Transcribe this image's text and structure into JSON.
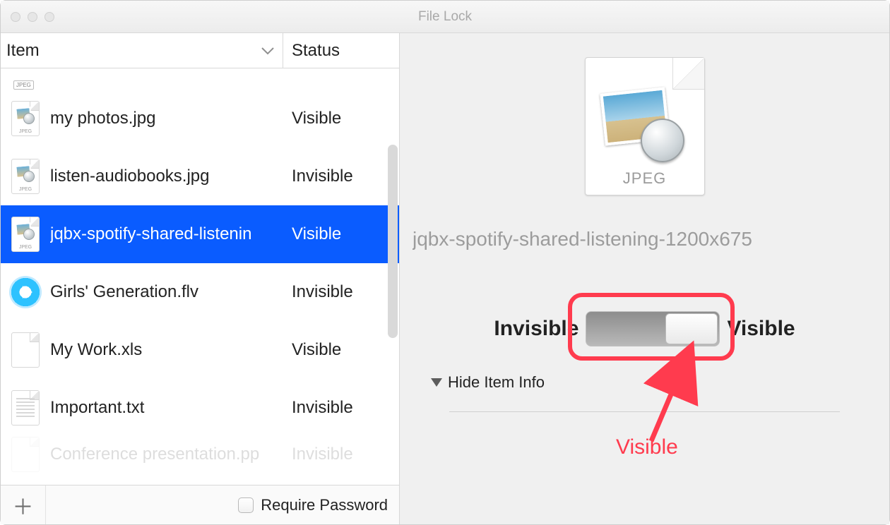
{
  "window": {
    "title": "File Lock"
  },
  "columns": {
    "item": "Item",
    "status": "Status"
  },
  "list": {
    "leading_tag": "JPEG",
    "items": [
      {
        "name": "my photos.jpg",
        "status": "Visible",
        "icon": "jpeg",
        "selected": false
      },
      {
        "name": "listen-audiobooks.jpg",
        "status": "Invisible",
        "icon": "jpeg",
        "selected": false
      },
      {
        "name": "jqbx-spotify-shared-listenin",
        "status": "Visible",
        "icon": "jpeg",
        "selected": true
      },
      {
        "name": "Girls' Generation.flv",
        "status": "Invisible",
        "icon": "flv",
        "selected": false
      },
      {
        "name": "My Work.xls",
        "status": "Visible",
        "icon": "xls",
        "selected": false
      },
      {
        "name": "Important.txt",
        "status": "Invisible",
        "icon": "txt",
        "selected": false
      }
    ],
    "trailing_partial": {
      "name": "Conference presentation.pp",
      "status": "Invisible"
    }
  },
  "bottom": {
    "require_password": "Require Password"
  },
  "detail": {
    "filetype_label": "JPEG",
    "filename": "jqbx-spotify-shared-listening-1200x675",
    "labels": {
      "invisible": "Invisible",
      "visible": "Visible"
    },
    "disclosure": "Hide Item Info"
  },
  "annotation": {
    "label": "Visible"
  }
}
